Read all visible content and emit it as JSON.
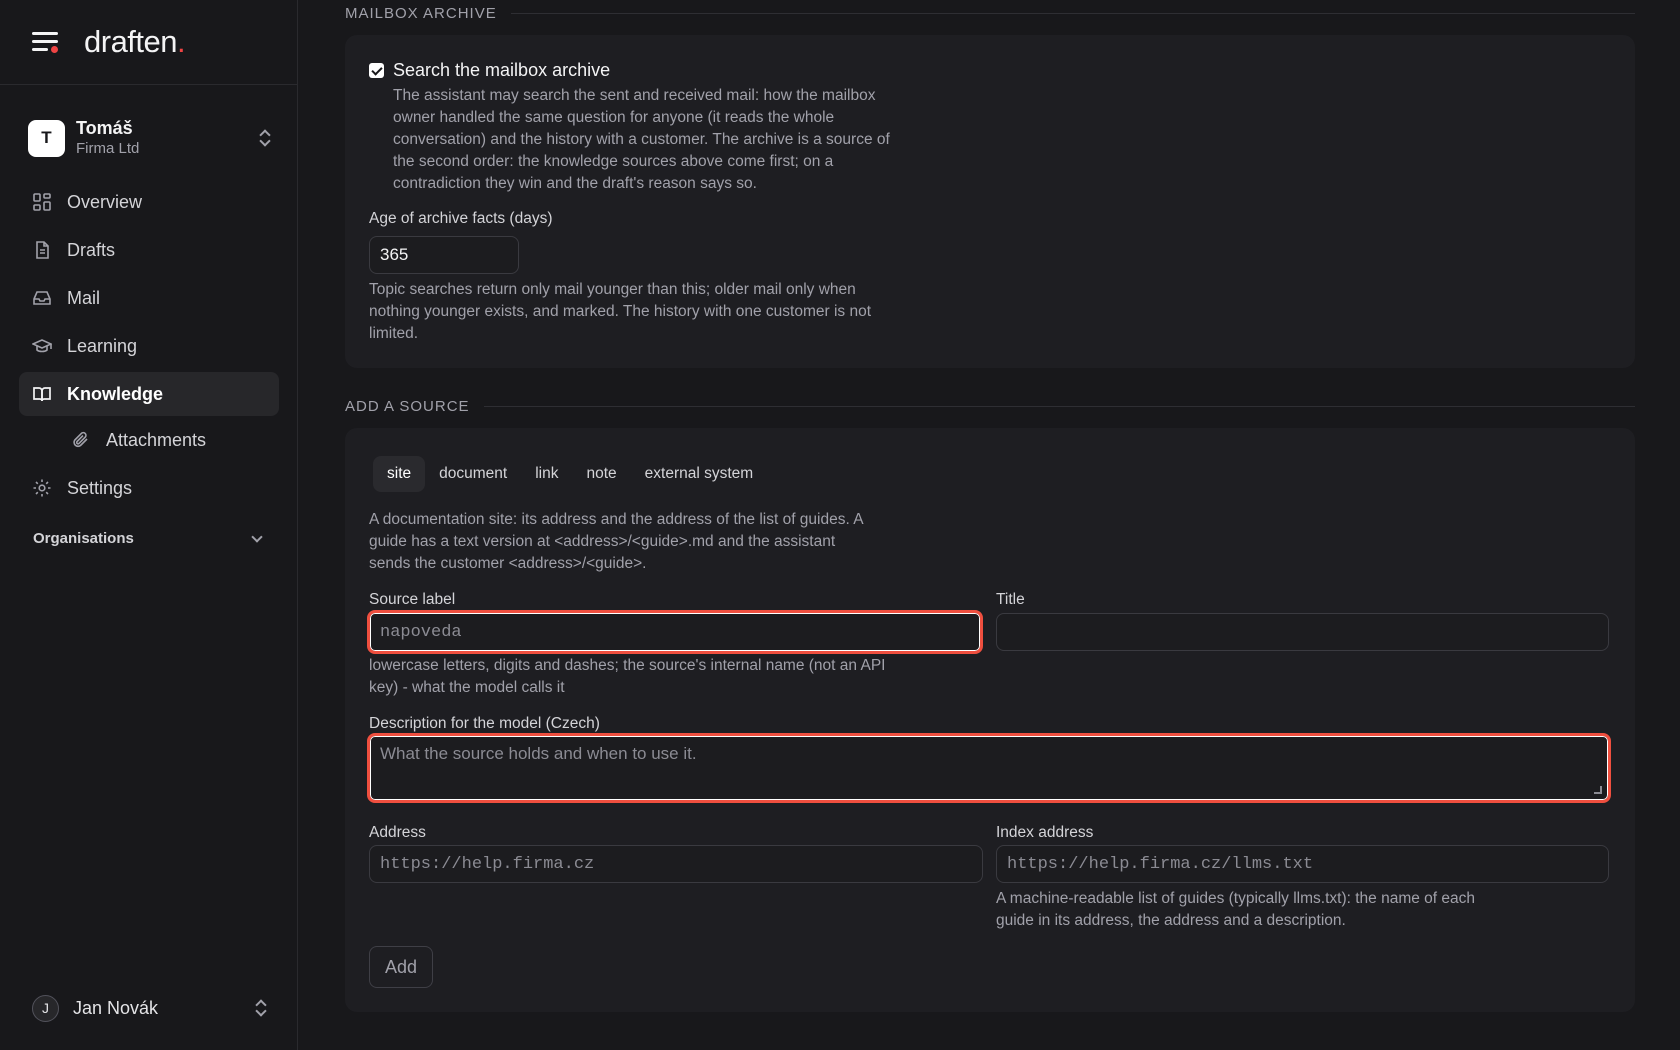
{
  "brand": {
    "logo_text": "draften",
    "logo_dot": "."
  },
  "org": {
    "avatar": "T",
    "name": "Tomáš",
    "subtitle": "Firma Ltd"
  },
  "nav": {
    "overview": "Overview",
    "drafts": "Drafts",
    "mail": "Mail",
    "learning": "Learning",
    "knowledge": "Knowledge",
    "attachments": "Attachments",
    "settings": "Settings"
  },
  "organisations_label": "Organisations",
  "user": {
    "avatar": "J",
    "name": "Jan Novák"
  },
  "archive": {
    "section_title": "MAILBOX ARCHIVE",
    "checkbox_label": "Search the mailbox archive",
    "checkbox_checked": true,
    "description": "The assistant may search the sent and received mail: how the mailbox owner handled the same question for anyone (it reads the whole conversation) and the history with a customer. The archive is a source of the second order: the knowledge sources above come first; on a contradiction they win and the draft's reason says so.",
    "age_label": "Age of archive facts (days)",
    "age_value": "365",
    "age_help": "Topic searches return only mail younger than this; older mail only when nothing younger exists, and marked. The history with one customer is not limited."
  },
  "add_source": {
    "section_title": "ADD A SOURCE",
    "tabs": [
      "site",
      "document",
      "link",
      "note",
      "external system"
    ],
    "active_tab": "site",
    "intro": "A documentation site: its address and the address of the list of guides. A guide has a text version at <address>/<guide>.md and the assistant sends the customer <address>/<guide>.",
    "source_label": "Source label",
    "source_placeholder": "napoveda",
    "source_help": "lowercase letters, digits and dashes; the source's internal name (not an API key) - what the model calls it",
    "title_label": "Title",
    "title_value": "",
    "description_label": "Description for the model (Czech)",
    "description_placeholder": "What the source holds and when to use it.",
    "address_label": "Address",
    "address_placeholder": "https://help.firma.cz",
    "index_label": "Index address",
    "index_placeholder": "https://help.firma.cz/llms.txt",
    "index_help": "A machine-readable list of guides (typically llms.txt): the name of each guide in its address, the address and a description.",
    "add_button": "Add"
  },
  "colors": {
    "accent": "#ef4444",
    "focus_ring": "#ef4f3f",
    "background": "#18181b",
    "card": "#1e1e22"
  }
}
